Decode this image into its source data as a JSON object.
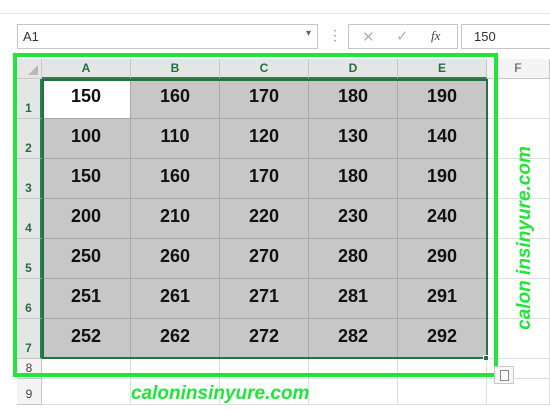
{
  "formula_bar": {
    "name_box": "A1",
    "formula_value": "150"
  },
  "icons": {
    "cancel": "✕",
    "enter": "✓",
    "fx": "fx",
    "dropdown": "▾",
    "dots": "⋮"
  },
  "columns": [
    "A",
    "B",
    "C",
    "D",
    "E",
    "F"
  ],
  "rows": [
    "1",
    "2",
    "3",
    "4",
    "5",
    "6",
    "7",
    "8",
    "9"
  ],
  "cells": [
    [
      "150",
      "160",
      "170",
      "180",
      "190"
    ],
    [
      "100",
      "110",
      "120",
      "130",
      "140"
    ],
    [
      "150",
      "160",
      "170",
      "180",
      "190"
    ],
    [
      "200",
      "210",
      "220",
      "230",
      "240"
    ],
    [
      "250",
      "260",
      "270",
      "280",
      "290"
    ],
    [
      "251",
      "261",
      "271",
      "281",
      "291"
    ],
    [
      "252",
      "262",
      "272",
      "282",
      "292"
    ]
  ],
  "watermarks": {
    "bottom": "caloninsinyure.com",
    "side": "calon insinyure.com"
  },
  "colors": {
    "selection_frame": "#21e53b",
    "range_fill": "#c7c7c7",
    "excel_green": "#217346"
  }
}
